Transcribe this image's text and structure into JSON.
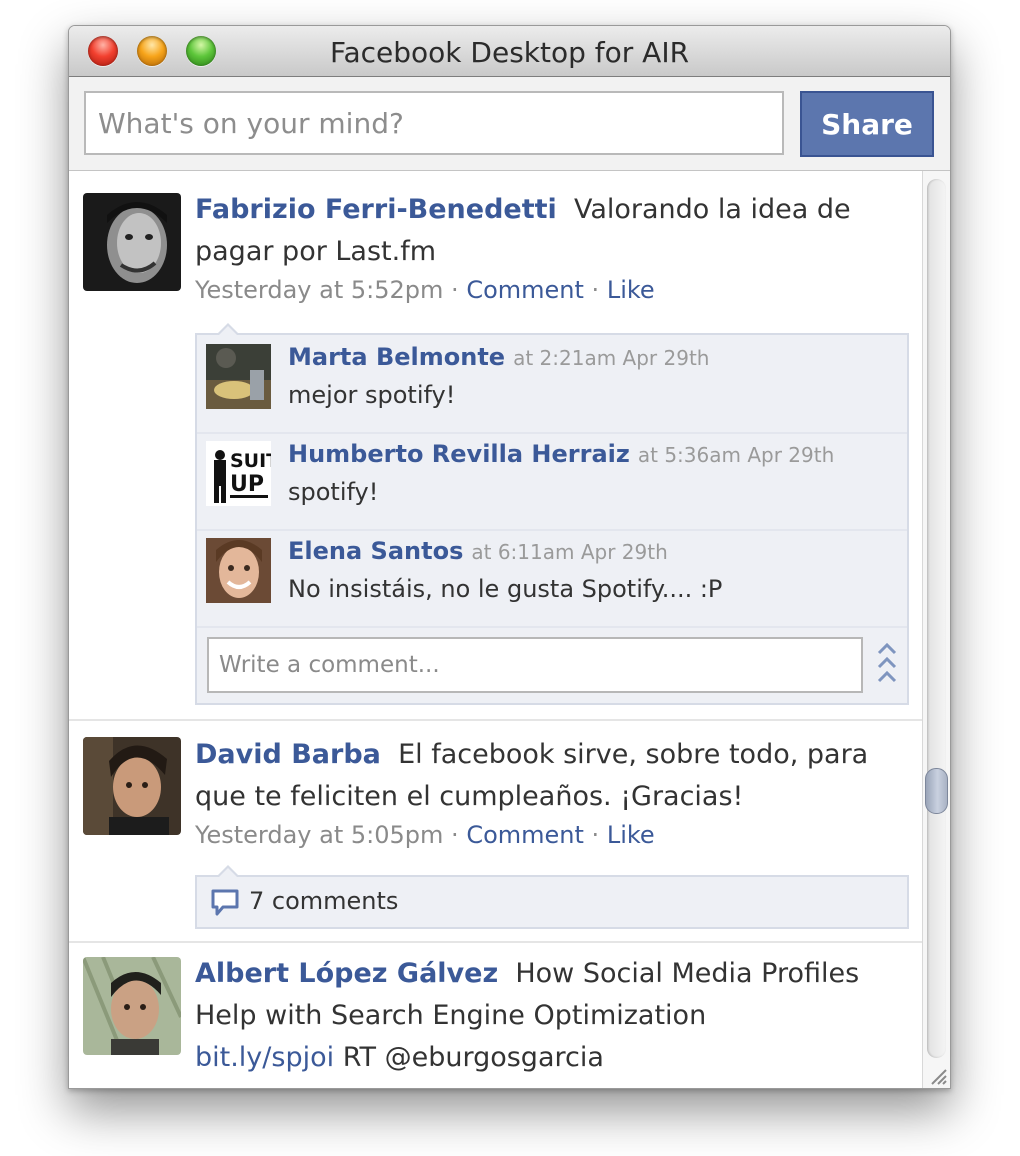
{
  "window": {
    "title": "Facebook Desktop for AIR"
  },
  "composer": {
    "placeholder": "What's on your mind?",
    "share_label": "Share"
  },
  "posts": [
    {
      "author": "Fabrizio Ferri-Benedetti",
      "text": "Valorando la idea de pagar por Last.fm",
      "time": "Yesterday at 5:52pm",
      "separator": "·",
      "comment_label": "Comment",
      "like_label": "Like",
      "comments": [
        {
          "author": "Marta Belmonte",
          "time": "at 2:21am Apr 29th",
          "text": "mejor spotify!"
        },
        {
          "author": "Humberto Revilla Herraiz",
          "time": "at 5:36am Apr 29th",
          "text": "spotify!"
        },
        {
          "author": "Elena Santos",
          "time": "at 6:11am Apr 29th",
          "text": "No insistáis, no le gusta Spotify.... :P"
        }
      ],
      "comment_placeholder": "Write a comment..."
    },
    {
      "author": "David Barba",
      "text": "El facebook sirve, sobre todo, para que te feliciten el cumpleaños. ¡Gracias!",
      "time": "Yesterday at 5:05pm",
      "separator": "·",
      "comment_label": "Comment",
      "like_label": "Like",
      "comment_count": "7 comments"
    },
    {
      "author": "Albert López Gálvez",
      "text": "How Social Media Profiles Help with Search Engine Optimization",
      "link": "bit.ly/spjoi",
      "extra": "RT @eburgosgarcia"
    }
  ],
  "icons": {
    "close": "close-traffic-light-icon",
    "minimize": "minimize-traffic-light-icon",
    "zoom": "zoom-traffic-light-icon",
    "comments": "speech-bubble-icon",
    "expand": "expand-chevrons-icon",
    "resize": "resize-grip-icon"
  },
  "colors": {
    "link": "#3b5998",
    "share_button": "#5c76ae",
    "muted": "#8a8a8a"
  }
}
